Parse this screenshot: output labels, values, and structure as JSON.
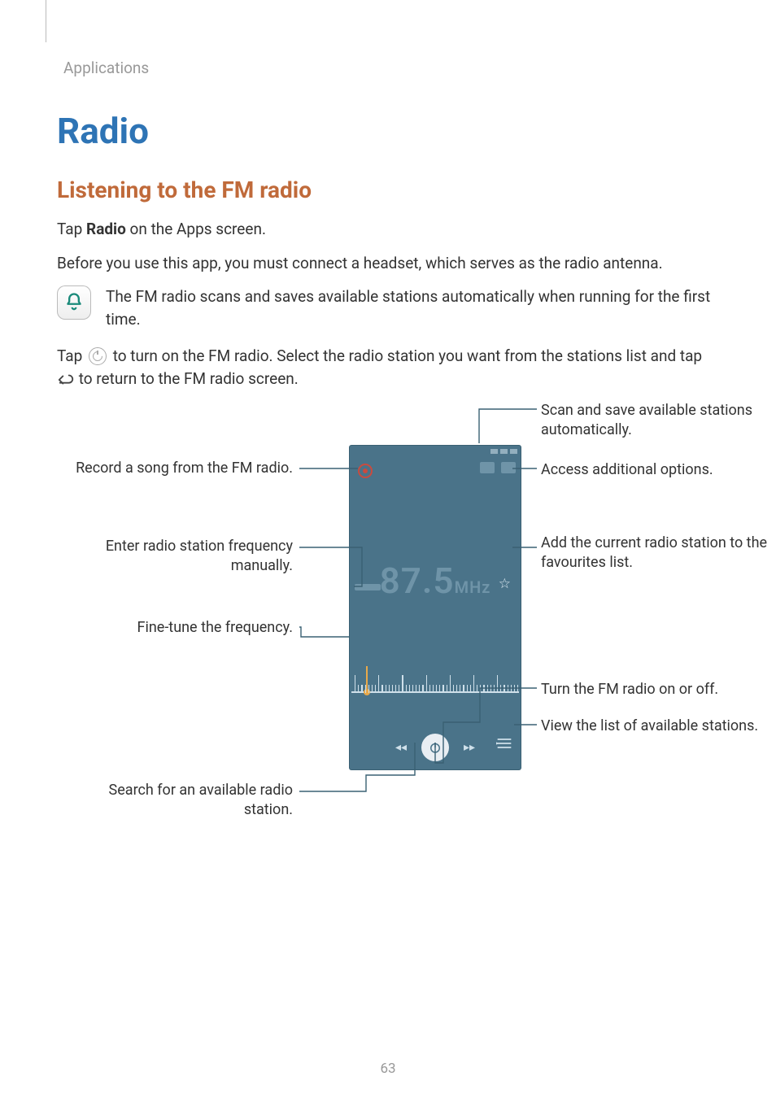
{
  "breadcrumb": "Applications",
  "title": "Radio",
  "subtitle": "Listening to the FM radio",
  "p1_pre": "Tap ",
  "p1_bold": "Radio",
  "p1_post": " on the Apps screen.",
  "p2": "Before you use this app, you must connect a headset, which serves as the radio antenna.",
  "note": "The FM radio scans and saves available stations automatically when running for the first time.",
  "p3_pre": "Tap ",
  "p3_mid": " to turn on the FM radio. Select the radio station you want from the stations list and tap ",
  "p3_post": " to return to the FM radio screen.",
  "icons": {
    "note_bell": "bell-icon",
    "inline_power": "power-icon",
    "inline_back": "back-arrow-icon"
  },
  "phone": {
    "frequency_display": "87.5",
    "frequency_unit": "MHz"
  },
  "callouts": {
    "record": "Record a song from the FM radio.",
    "enter_freq": "Enter radio station frequency manually.",
    "fine_tune": "Fine-tune the frequency.",
    "search": "Search for an available radio station.",
    "scan_save": "Scan and save available stations automatically.",
    "more_options": "Access additional options.",
    "add_fav": "Add the current radio station to the favourites list.",
    "power": "Turn the FM radio on or off.",
    "station_list": "View the list of available stations."
  },
  "page_number": "63"
}
